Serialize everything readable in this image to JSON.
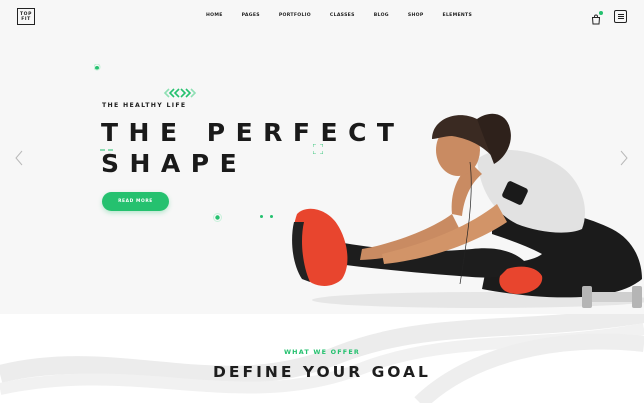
{
  "logo": {
    "line1": "TOP",
    "line2": "FIT"
  },
  "nav": {
    "items": [
      {
        "label": "HOME"
      },
      {
        "label": "PAGES"
      },
      {
        "label": "PORTFOLIO"
      },
      {
        "label": "CLASSES"
      },
      {
        "label": "BLOG"
      },
      {
        "label": "SHOP"
      },
      {
        "label": "ELEMENTS"
      }
    ]
  },
  "header": {
    "cart_icon": "shopping-bag-icon",
    "menu_icon": "hamburger-menu-icon"
  },
  "hero": {
    "subtitle": "THE HEALTHY LIFE",
    "title": "THE PERFECT\nSHAPE",
    "cta_label": "READ MORE",
    "prev_icon": "chevron-left-icon",
    "next_icon": "chevron-right-icon"
  },
  "offer": {
    "kicker": "WHAT WE OFFER",
    "title": "DEFINE YOUR GOAL"
  },
  "colors": {
    "accent": "#25c16f",
    "text": "#1e1e1e",
    "hero_bg": "#f7f7f7"
  }
}
